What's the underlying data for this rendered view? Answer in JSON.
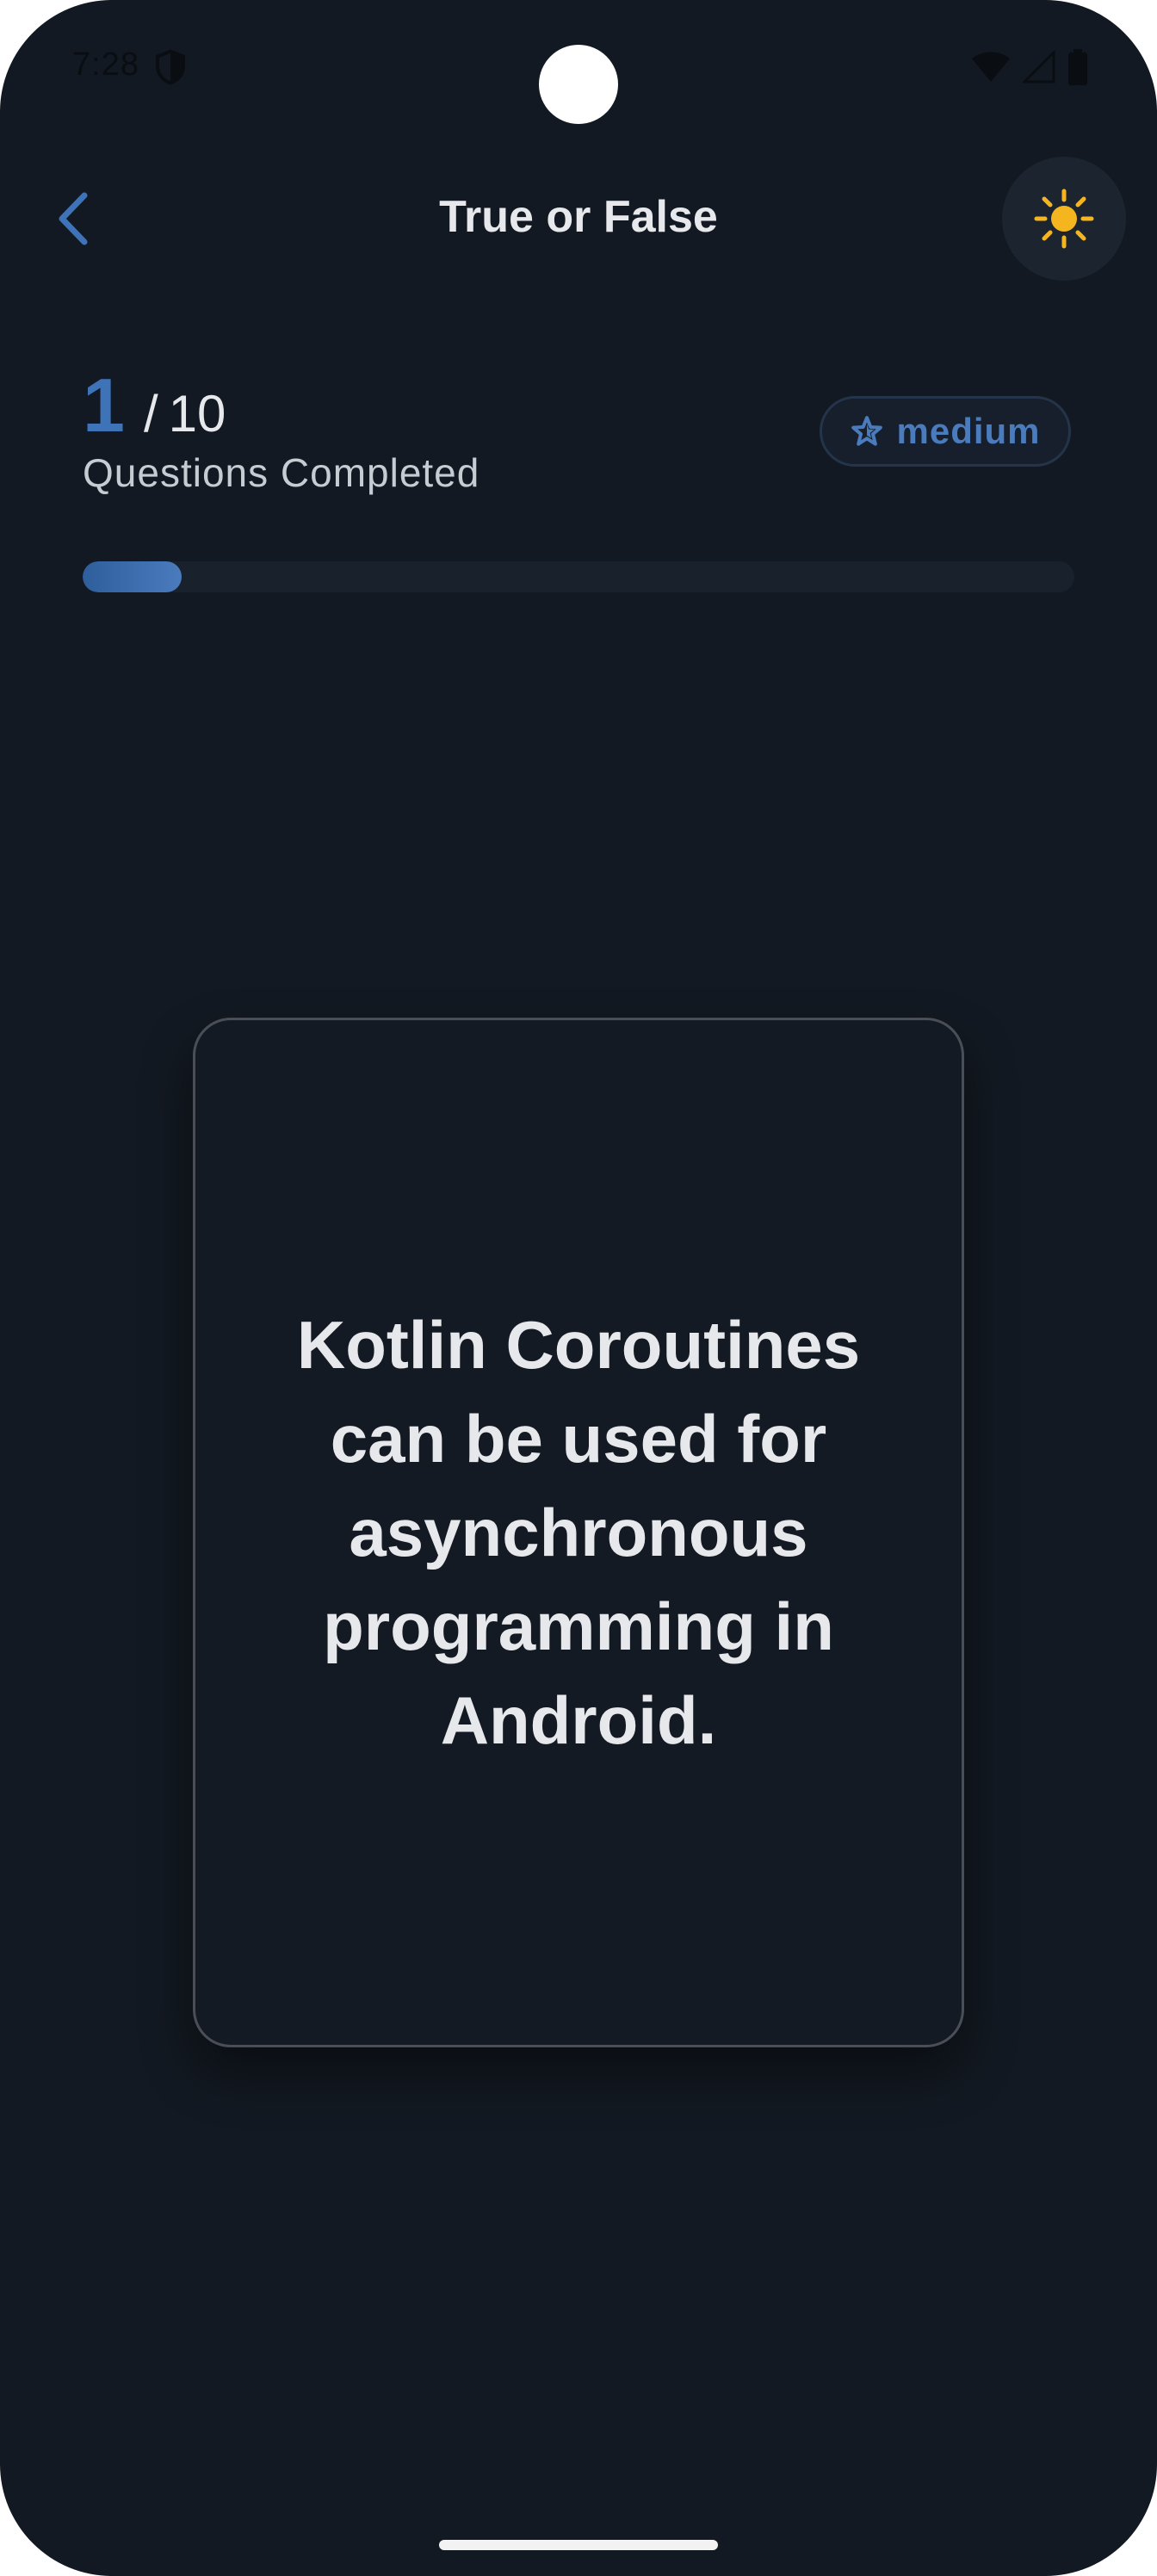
{
  "status_bar": {
    "time": "7:28",
    "icons": [
      "shield-icon",
      "wifi-icon",
      "cellular-signal-icon",
      "battery-icon"
    ]
  },
  "app_bar": {
    "title": "True or False",
    "back_icon": "chevron-left-icon",
    "theme_icon": "sun-icon"
  },
  "progress": {
    "current": "1",
    "separator": "/",
    "total": "10",
    "caption": "Questions Completed",
    "fraction": 0.1
  },
  "difficulty": {
    "icon": "star-icon",
    "label": "medium"
  },
  "question": {
    "text": "Kotlin Coroutines can be used for asynchronous programming in Android."
  },
  "colors": {
    "background": "#131922",
    "accent": "#3e73b8",
    "text_primary": "#e6e8eb",
    "sun": "#f5b51e"
  }
}
